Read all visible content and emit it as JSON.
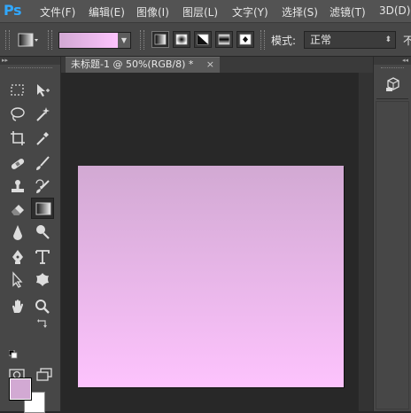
{
  "app": {
    "logo": "Ps"
  },
  "menu": {
    "items": [
      {
        "label": "文件(F)"
      },
      {
        "label": "编辑(E)"
      },
      {
        "label": "图像(I)"
      },
      {
        "label": "图层(L)"
      },
      {
        "label": "文字(Y)"
      },
      {
        "label": "选择(S)"
      },
      {
        "label": "滤镜(T)"
      },
      {
        "label": "3D(D)"
      }
    ]
  },
  "options": {
    "gradient_colors": [
      "#d2a9d3",
      "#fdc3fd"
    ],
    "gradient_types": [
      "linear-gradient-icon",
      "radial-gradient-icon",
      "angle-gradient-icon",
      "reflected-gradient-icon",
      "diamond-gradient-icon"
    ],
    "selected_gradient_type": "linear-gradient-icon",
    "mode_label": "模式:",
    "mode_value": "正常",
    "trailing_label": "不"
  },
  "document": {
    "tab_title": "未标题-1 @ 50%(RGB/8) *",
    "close_glyph": "×"
  },
  "tools": {
    "active": "gradient-tool",
    "foreground_color": "#d2a9d3",
    "background_color": "#ffffff"
  },
  "canvas": {
    "top_color": "#d2a9d3",
    "bottom_color": "#fdc3fd"
  },
  "panels": {
    "collapse_glyph": "◂◂",
    "expand_glyph": "▸▸"
  }
}
